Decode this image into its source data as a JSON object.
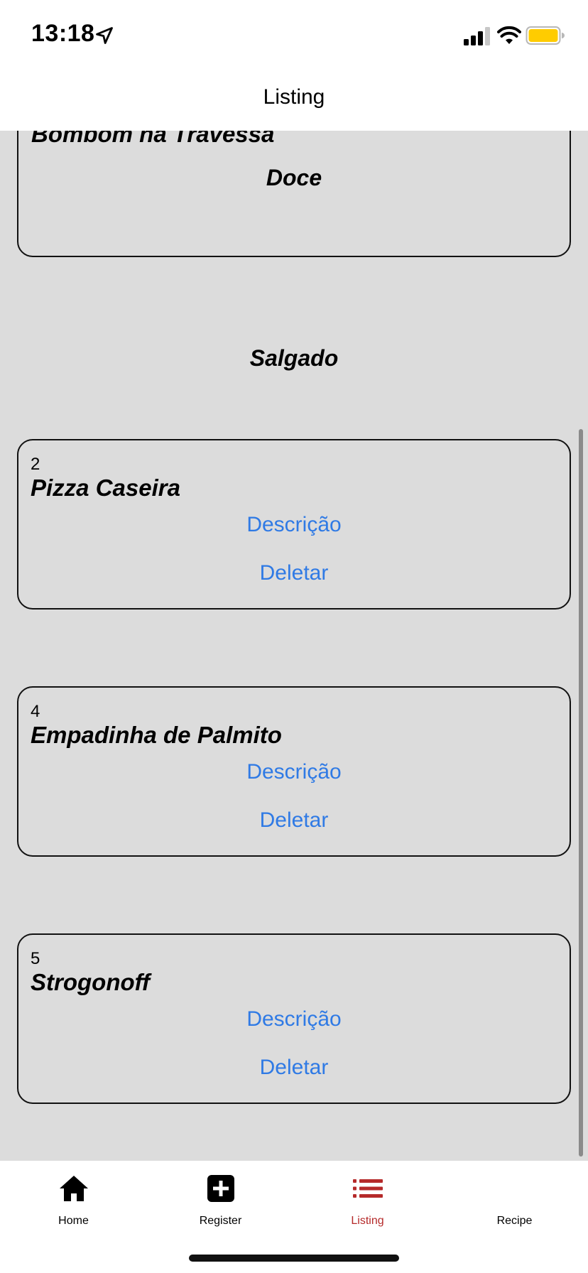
{
  "status_bar": {
    "time": "13:18"
  },
  "header": {
    "title": "Listing"
  },
  "partial_card": {
    "name": "Bombom na Travessa",
    "category": "Doce"
  },
  "section": {
    "title": "Salgado"
  },
  "recipes": [
    {
      "id": "2",
      "name": "Pizza Caseira",
      "description_label": "Descrição",
      "delete_label": "Deletar"
    },
    {
      "id": "4",
      "name": "Empadinha de Palmito",
      "description_label": "Descrição",
      "delete_label": "Deletar"
    },
    {
      "id": "5",
      "name": "Strogonoff",
      "description_label": "Descrição",
      "delete_label": "Deletar"
    }
  ],
  "tabs": [
    {
      "label": "Home",
      "icon": "home-icon",
      "active": false
    },
    {
      "label": "Register",
      "icon": "plus-square-icon",
      "active": false
    },
    {
      "label": "Listing",
      "icon": "list-icon",
      "active": true
    },
    {
      "label": "Recipe",
      "icon": "none",
      "active": false
    }
  ],
  "colors": {
    "link": "#2f7ae5",
    "active_tab": "#b52a2a",
    "background": "#dcdcdc",
    "battery": "#ffcc00"
  }
}
